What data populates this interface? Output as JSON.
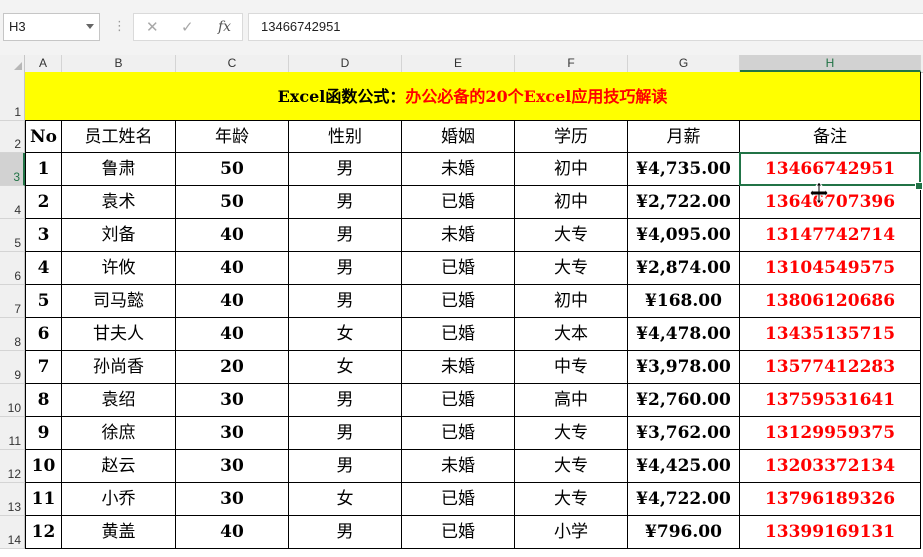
{
  "formula_bar": {
    "name_box": "H3",
    "cancel_glyph": "✕",
    "enter_glyph": "✓",
    "fx_glyph": "fx",
    "formula_value": "13466742951"
  },
  "columns": [
    "A",
    "B",
    "C",
    "D",
    "E",
    "F",
    "G",
    "H"
  ],
  "selected_column": "H",
  "row_numbers": [
    "1",
    "2",
    "3",
    "4",
    "5",
    "6",
    "7",
    "8",
    "9",
    "10",
    "11",
    "12",
    "13",
    "14"
  ],
  "selected_row": "3",
  "title": {
    "part1": "Excel函数公式：",
    "part2": "办公必备的20个Excel应用技巧解读"
  },
  "headers": [
    "No",
    "员工姓名",
    "年龄",
    "性别",
    "婚姻",
    "学历",
    "月薪",
    "备注"
  ],
  "rows": [
    [
      "1",
      "鲁肃",
      "50",
      "男",
      "未婚",
      "初中",
      "¥4,735.00",
      "13466742951"
    ],
    [
      "2",
      "袁术",
      "50",
      "男",
      "已婚",
      "初中",
      "¥2,722.00",
      "13646707396"
    ],
    [
      "3",
      "刘备",
      "40",
      "男",
      "未婚",
      "大专",
      "¥4,095.00",
      "13147742714"
    ],
    [
      "4",
      "许攸",
      "40",
      "男",
      "已婚",
      "大专",
      "¥2,874.00",
      "13104549575"
    ],
    [
      "5",
      "司马懿",
      "40",
      "男",
      "已婚",
      "初中",
      "¥168.00",
      "13806120686"
    ],
    [
      "6",
      "甘夫人",
      "40",
      "女",
      "已婚",
      "大本",
      "¥4,478.00",
      "13435135715"
    ],
    [
      "7",
      "孙尚香",
      "20",
      "女",
      "未婚",
      "中专",
      "¥3,978.00",
      "13577412283"
    ],
    [
      "8",
      "袁绍",
      "30",
      "男",
      "已婚",
      "高中",
      "¥2,760.00",
      "13759531641"
    ],
    [
      "9",
      "徐庶",
      "30",
      "男",
      "已婚",
      "大专",
      "¥3,762.00",
      "13129959375"
    ],
    [
      "10",
      "赵云",
      "30",
      "男",
      "未婚",
      "大专",
      "¥4,425.00",
      "13203372134"
    ],
    [
      "11",
      "小乔",
      "30",
      "女",
      "已婚",
      "大专",
      "¥4,722.00",
      "13796189326"
    ],
    [
      "12",
      "黄盖",
      "40",
      "男",
      "已婚",
      "小学",
      "¥796.00",
      "13399169131"
    ]
  ],
  "colors": {
    "title_bg": "#ffff00",
    "title_red": "#ff0000",
    "note_red": "#ff0000",
    "selection": "#217346"
  },
  "icons": [
    "dropdown-arrow-icon",
    "cancel-icon",
    "enter-icon",
    "fx-icon",
    "move-cursor-icon"
  ]
}
